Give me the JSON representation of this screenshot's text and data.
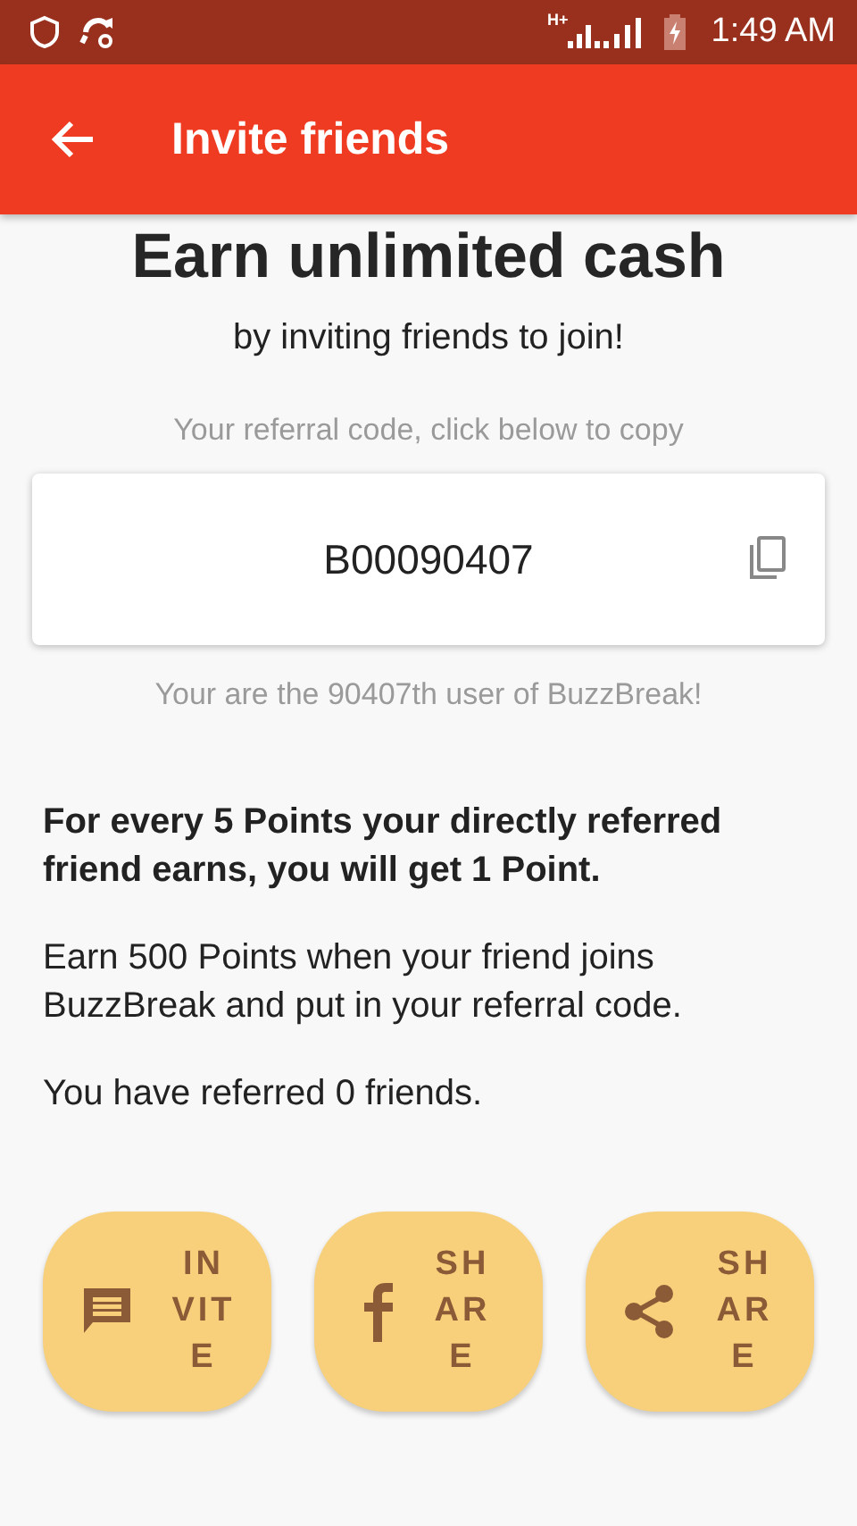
{
  "status_bar": {
    "time": "1:49 AM",
    "network": "H+"
  },
  "app_bar": {
    "title": "Invite friends"
  },
  "headline": "Earn unlimited cash",
  "subheadline": "by inviting friends to join!",
  "referral": {
    "hint": "Your referral code, click below to copy",
    "code": "B00090407",
    "note": "Your are the 90407th user of BuzzBreak!"
  },
  "paragraphs": [
    {
      "kind": "bold",
      "text": "For every 5 Points your directly referred friend earns, you will get 1 Point."
    },
    {
      "kind": "plain",
      "text": "Earn 500 Points when your friend joins BuzzBreak and put in your referral code."
    },
    {
      "kind": "plain",
      "text": "You have referred 0 friends."
    }
  ],
  "actions": [
    {
      "kind": "message",
      "label": "INVITE"
    },
    {
      "kind": "facebook",
      "label": "SHARE"
    },
    {
      "kind": "share",
      "label": "SHARE"
    }
  ]
}
